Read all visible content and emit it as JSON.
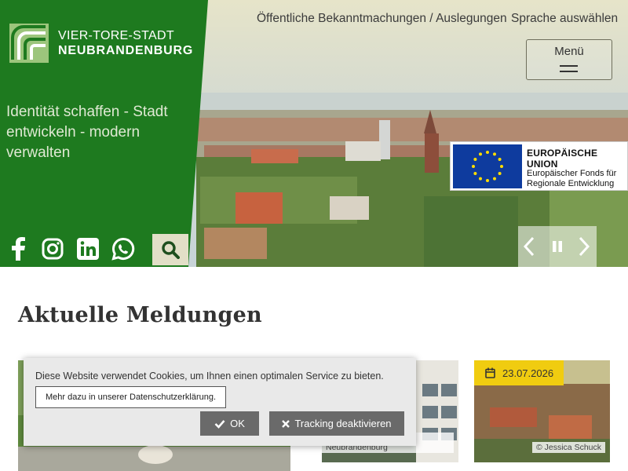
{
  "header": {
    "logo_line1": "VIER-TORE-STADT",
    "logo_line2": "NEUBRANDENBURG",
    "tagline": "Identität schaffen - Stadt entwickeln - modern verwalten",
    "nav_announcements": "Öffentliche Bekanntmachungen / Auslegungen",
    "nav_language": "Sprache auswählen",
    "menu_label": "Menü",
    "social_icons": [
      "facebook-icon",
      "instagram-icon",
      "linkedin-icon",
      "whatsapp-icon"
    ],
    "brand_color": "#1d7a1d"
  },
  "eu_badge": {
    "title": "EUROPÄISCHE UNION",
    "subtitle_line1": "Europäischer Fonds für",
    "subtitle_line2": "Regionale Entwicklung"
  },
  "news": {
    "section_title": "Aktuelle Meldungen",
    "cards": [
      {
        "credit": ""
      },
      {
        "credit": "© Vier-Tore-Stadt Neubrandenburg"
      },
      {
        "credit": "© Jessica Schuck",
        "date": "23.07.2026"
      }
    ]
  },
  "cookie_banner": {
    "text": "Diese Website verwendet Cookies, um Ihnen einen optimalen Service zu bieten.",
    "privacy_link": "Mehr dazu in unserer Datenschutzerklärung.",
    "ok_label": "OK",
    "tracking_label": "Tracking deaktivieren"
  }
}
